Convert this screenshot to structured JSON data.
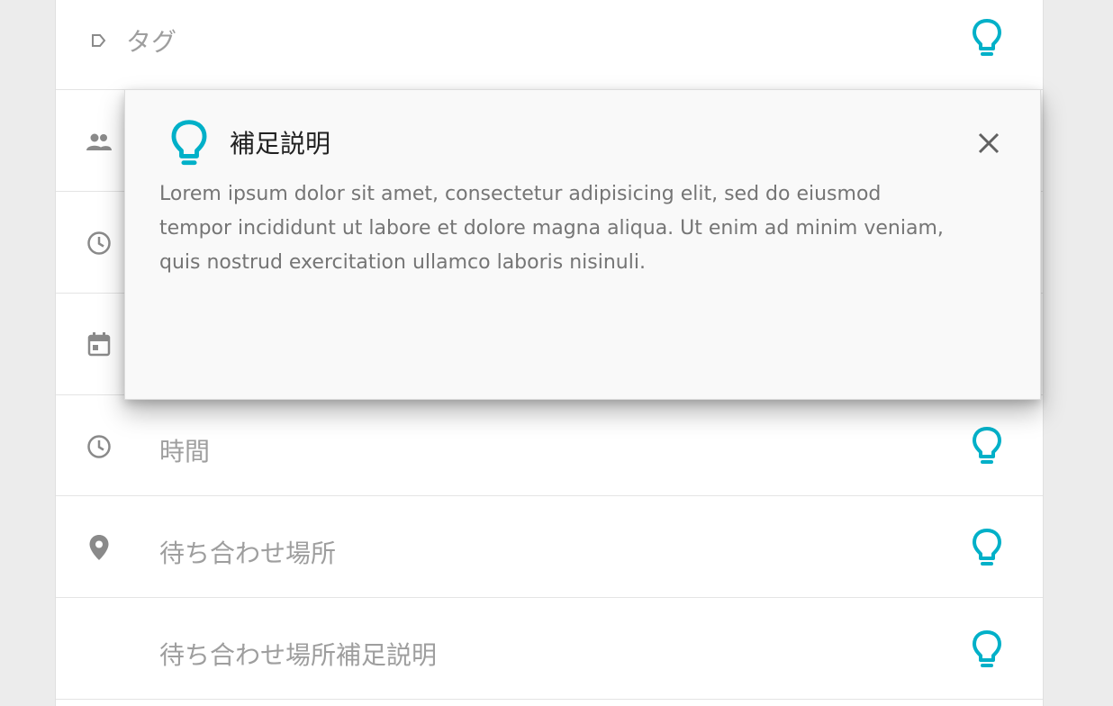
{
  "colors": {
    "accent": "#00b0c8",
    "icon_grey": "#8a8a8a",
    "placeholder": "#9e9e9e"
  },
  "fields": [
    {
      "icon": "tag-icon",
      "label": "タグ"
    },
    {
      "icon": "people-icon",
      "label": ""
    },
    {
      "icon": "clock-icon",
      "label": ""
    },
    {
      "icon": "calendar-icon",
      "label": ""
    },
    {
      "icon": "clock-icon",
      "label": "時間"
    },
    {
      "icon": "location-pin-icon",
      "label": "待ち合わせ場所"
    },
    {
      "icon": "",
      "label": "待ち合わせ場所補足説明"
    }
  ],
  "popup": {
    "icon": "lightbulb-icon",
    "title": "補足説明",
    "close_icon": "close-icon",
    "body": "Lorem ipsum dolor sit amet, consectetur adipisicing elit, sed do eiusmod tempor incididunt ut labore et dolore magna aliqua. Ut enim ad minim veniam, quis nostrud exercitation ullamco laboris nisinuli."
  }
}
